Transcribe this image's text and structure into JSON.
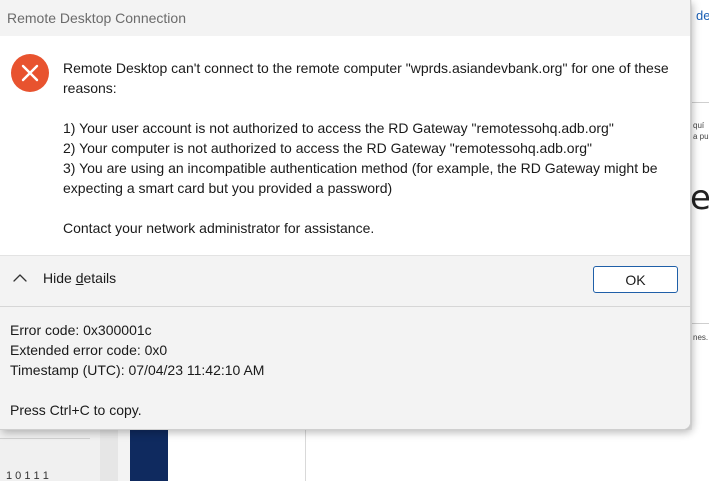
{
  "dialog": {
    "title": "Remote Desktop Connection",
    "icon": "error-icon",
    "message": {
      "intro": "Remote Desktop can't connect to the remote computer \"wprds.asiandevbank.org\" for one of these reasons:",
      "reasons": [
        "1) Your user account is not authorized to access the RD Gateway \"remotessohq.adb.org\"",
        "2) Your computer is not authorized to access the RD Gateway \"remotessohq.adb.org\"",
        "3) You are using an incompatible authentication method (for example, the RD Gateway might be expecting a smart card but you provided a password)"
      ],
      "footer": "Contact your network administrator for assistance."
    },
    "details_toggle": {
      "label_prefix": "Hide ",
      "label_access_key": "d",
      "label_suffix": "etails",
      "icon": "chevron-up-icon"
    },
    "ok_label": "OK",
    "details": {
      "error_code": "Error code: 0x300001c",
      "extended_error_code": "Extended error code: 0x0",
      "timestamp": "Timestamp (UTC): 07/04/23 11:42:10 AM",
      "copy_hint": "Press Ctrl+C to copy."
    }
  },
  "background": {
    "right_link": "de",
    "right_text_1": "quí\na pu",
    "right_big": "e",
    "right_text_2": "nes.",
    "left_text": "1 0 1 1 1"
  },
  "colors": {
    "error_red": "#e8532f",
    "ok_border": "#1f5fa8",
    "navy": "#0f2a5f"
  }
}
